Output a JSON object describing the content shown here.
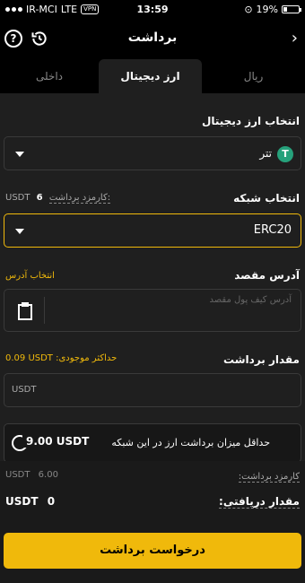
{
  "status_bar": {
    "carrier": "IR-MCI",
    "network": "LTE",
    "vpn": "VPN",
    "time": "13:59",
    "battery": "19%"
  },
  "header": {
    "title": "برداشت",
    "back_icon": "chevron-right-icon",
    "help_icon": "question-circle-icon",
    "history_icon": "history-icon"
  },
  "tabs": [
    {
      "label": "ریال"
    },
    {
      "label": "ارز دیجیتال"
    },
    {
      "label": "داخلی"
    }
  ],
  "currency": {
    "label": "انتخاب ارز دیجیتال",
    "value": "تتر",
    "icon_letter": "T"
  },
  "network": {
    "label": "انتخاب شبکه",
    "fee_label": "کارمزد برداشت:",
    "fee_value": "6",
    "fee_unit": "USDT",
    "value": "ERC20"
  },
  "address": {
    "label": "آدرس مقصد",
    "select_link": "انتخاب آدرس",
    "placeholder": "آدرس کیف پول مقصد"
  },
  "amount": {
    "label": "مقدار برداشت",
    "max_label": "حداکثر موجودی:",
    "max_value": "0.09 USDT",
    "unit": "USDT"
  },
  "notice": {
    "text": "حداقل میزان برداشت ارز در این شبکه",
    "value": "9.00 USDT"
  },
  "summary": {
    "fee_label": "کارمزد برداشت:",
    "fee_value": "6.00",
    "receive_label": "مقدار دریافتی:",
    "receive_value": "0",
    "unit": "USDT"
  },
  "submit": {
    "label": "درخواست برداشت"
  },
  "colors": {
    "accent": "#f0b90b",
    "tether": "#26a17b",
    "panel": "#1f1f1f"
  }
}
